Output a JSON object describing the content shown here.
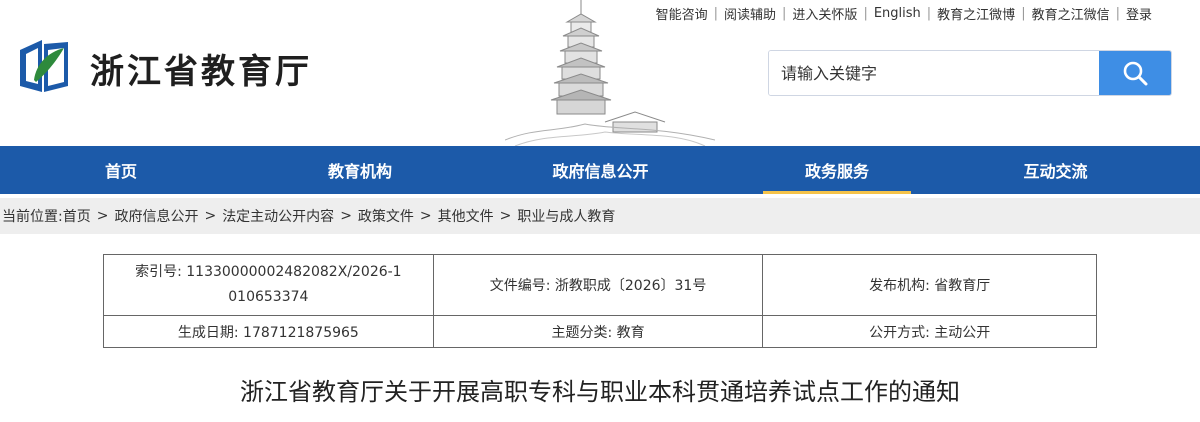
{
  "header": {
    "site_title": "浙江省教育厅",
    "top_links": [
      "智能咨询",
      "阅读辅助",
      "进入关怀版",
      "English",
      "教育之江微博",
      "教育之江微信",
      "登录"
    ],
    "search": {
      "placeholder": "请输入关键字"
    }
  },
  "nav": {
    "items": [
      {
        "label": "首页",
        "active": false
      },
      {
        "label": "教育机构",
        "active": false
      },
      {
        "label": "政府信息公开",
        "active": false
      },
      {
        "label": "政务服务",
        "active": true
      },
      {
        "label": "互动交流",
        "active": false
      }
    ]
  },
  "breadcrumb": {
    "prefix": "当前位置:",
    "items": [
      "首页",
      "政府信息公开",
      "法定主动公开内容",
      "政策文件",
      "其他文件",
      "职业与成人教育"
    ]
  },
  "info": {
    "index_no": "索引号: 11330000002482082X/2026-1010653374",
    "doc_no": "文件编号: 浙教职成〔2026〕31号",
    "publisher": "发布机构: 省教育厅",
    "created": "生成日期: 1787121875965",
    "topic": "主题分类: 教育",
    "mode": "公开方式: 主动公开"
  },
  "article": {
    "title": "浙江省教育厅关于开展高职专科与职业本科贯通培养试点工作的通知"
  },
  "colors": {
    "nav_bg": "#1c5aa9",
    "nav_active_underline": "#f5c34a",
    "search_button": "#3e8ee5",
    "logo_green": "#2e8a3c",
    "logo_blue": "#1c5aa9"
  }
}
